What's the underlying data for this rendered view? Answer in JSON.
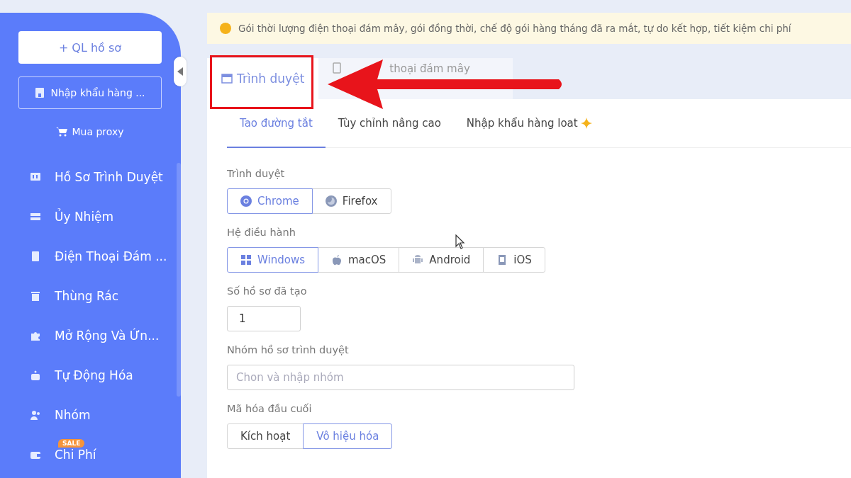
{
  "sidebar": {
    "primary_button": "+ QL hồ sơ",
    "import_button": "Nhập khẩu hàng ...",
    "proxy_link": "Mua proxy",
    "items": [
      {
        "label": "Hồ Sơ Trình Duyệt"
      },
      {
        "label": "Ủy Nhiệm"
      },
      {
        "label": "Điện Thoại Đám ..."
      },
      {
        "label": "Thùng Rác"
      },
      {
        "label": "Mở Rộng Và Ứn..."
      },
      {
        "label": "Tự Động Hóa"
      },
      {
        "label": "Nhóm"
      },
      {
        "label": "Chi Phí",
        "badge": "SALE"
      }
    ]
  },
  "notice": {
    "text": "Gói thời lượng điện thoại đám mây, gói đồng thời, chế độ gói hàng tháng đã ra mắt, tự do kết hợp, tiết kiệm chi phí"
  },
  "top_tabs": [
    {
      "label": "Trình duyệt",
      "selected": true
    },
    {
      "label": "thoại đám mây",
      "selected": false
    }
  ],
  "sub_tabs": [
    {
      "label": "Tao đường tắt",
      "selected": true,
      "kind": "plain"
    },
    {
      "label": "Tùy chỉnh nâng cao",
      "selected": false,
      "kind": "plain"
    },
    {
      "label": "Nhập khẩu hàng loat",
      "selected": false,
      "kind": "featured"
    }
  ],
  "form": [
    {
      "label": "Trình duyệt",
      "kind": "segmented",
      "options": [
        {
          "label": "Chrome",
          "selected": true
        },
        {
          "label": "Firefox",
          "selected": false
        }
      ]
    },
    {
      "label": "Hệ điều hành",
      "kind": "segmented",
      "options": [
        {
          "label": "Windows",
          "selected": true
        },
        {
          "label": "macOS",
          "selected": false
        },
        {
          "label": "Android",
          "selected": false
        },
        {
          "label": "iOS",
          "selected": false
        }
      ]
    },
    {
      "label": "Số hồ sơ đã tạo",
      "kind": "number",
      "value": "1"
    },
    {
      "label": "Nhóm hồ sơ trình duyệt",
      "kind": "select",
      "placeholder": "Chon và nhập nhóm"
    },
    {
      "label": "Mã hóa đầu cuối",
      "kind": "segmented",
      "options": [
        {
          "label": "Kích hoạt",
          "selected": false
        },
        {
          "label": "Vô hiệu hóa",
          "selected": true
        }
      ]
    }
  ]
}
